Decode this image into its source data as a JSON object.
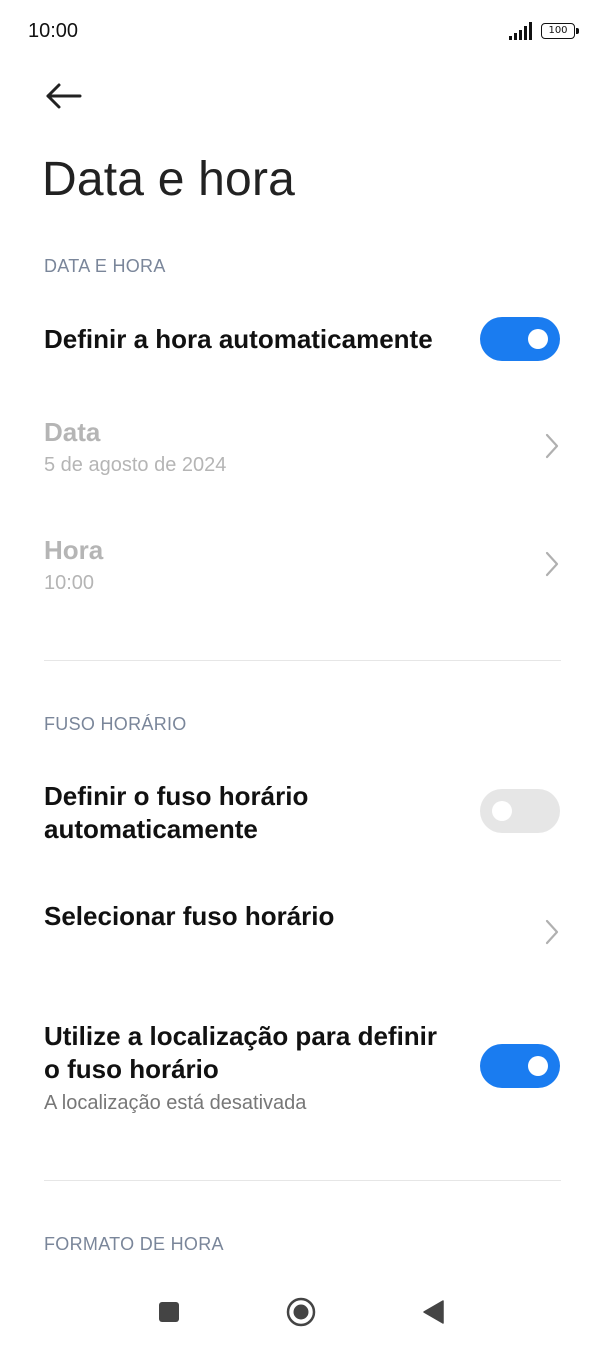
{
  "status_bar": {
    "time": "10:00",
    "battery": "100"
  },
  "header": {
    "back_icon": "arrow-left-icon",
    "title": "Data e hora"
  },
  "sections": {
    "date_time": {
      "header": "DATA E HORA",
      "auto_time": {
        "label": "Definir a hora automaticamente",
        "enabled": true
      },
      "date": {
        "label": "Data",
        "value": "5 de agosto de 2024"
      },
      "time": {
        "label": "Hora",
        "value": "10:00"
      }
    },
    "timezone": {
      "header": "FUSO HORÁRIO",
      "auto_timezone": {
        "label_line1": "Definir o fuso horário",
        "label_line2": "automaticamente",
        "enabled": false
      },
      "select_timezone": {
        "label": "Selecionar fuso horário"
      },
      "use_location": {
        "label_line1": "Utilize a localização para definir",
        "label_line2": "o fuso horário",
        "subtitle": "A localização está desativada",
        "enabled": true
      }
    },
    "time_format": {
      "header": "FORMATO DE HORA"
    }
  },
  "colors": {
    "accent": "#1a7cf0",
    "toggle_off": "#e6e6e6",
    "section_header": "#7a869a",
    "disabled_text": "#b5b5b5"
  },
  "nav_bar": {
    "recents_icon": "square-icon",
    "home_icon": "circle-home-icon",
    "back_icon": "triangle-back-icon"
  }
}
